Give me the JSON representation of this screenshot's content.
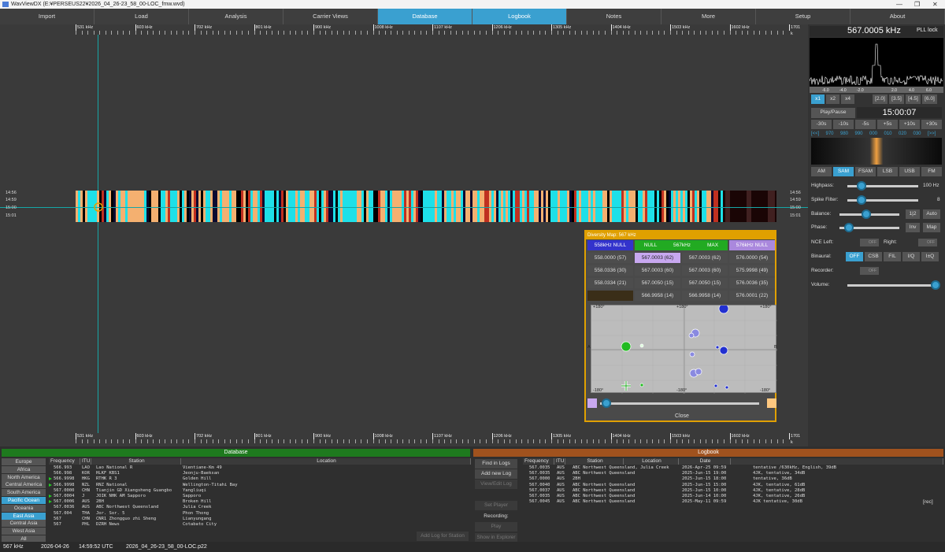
{
  "window": {
    "title": "WavViewDX (E:¥PERSEUS22¥2026_04_26-23_58_00-LOC_fmw.wvd)",
    "controls": [
      "—",
      "❐",
      "✕"
    ]
  },
  "menu": [
    "Import",
    "Load",
    "Analysis",
    "Carrier Views",
    "Database",
    "Logbook",
    "Notes",
    "More",
    "Setup",
    "About"
  ],
  "ruler": [
    "531 kHz",
    "603 kHz",
    "702 kHz",
    "801 kHz",
    "900 kHz",
    "1008 kHz",
    "1107 kHz",
    "1206 kHz",
    "1305 kHz",
    "1404 kHz",
    "1503 kHz",
    "1602 kHz",
    "1701 k"
  ],
  "times_left": [
    "14:56",
    "14:59",
    "15:00",
    "15:01"
  ],
  "times_right": [
    "14:56",
    "14:59",
    "15:00",
    "15:01"
  ],
  "diversity": {
    "title": "Diversity Map: 567 kHz",
    "headers": [
      "558kHz NULL",
      "NULL",
      "567kHz",
      "MAX",
      "576kHz NULL"
    ],
    "col1": [
      "558.0000 (57)",
      "558.0336 (30)",
      "558.0334 (21)",
      ""
    ],
    "col2": [
      "567.0003 (62)",
      "567.0003 (60)",
      "567.0050 (15)",
      "566.9958 (14)"
    ],
    "col3": [
      "567.0003 (62)",
      "567.0003 (60)",
      "567.0050 (15)",
      "566.9958 (14)"
    ],
    "col4": [
      "576.0000 (54)",
      "575.9998 (49)",
      "576.0036 (35)",
      "576.0001 (22)"
    ],
    "plot_labels": {
      "tl": "+180°",
      "tc": "+180°",
      "tr": "+180°",
      "bl": "-180°",
      "bc": "-180°",
      "br": "-180°",
      "left": "A",
      "right": "B"
    },
    "close": "Close",
    "colors": {
      "header": "#e0a000",
      "null558": "#3333cc",
      "null567": "#22aa22",
      "null576": "#aa88dd",
      "sel": "#c8a8f0"
    }
  },
  "receiver": {
    "frequency": "567.0005 kHz",
    "pll": "PLL lock",
    "spec_ticks": [
      "-6.0",
      "-4.0",
      "-2.0",
      "",
      "2.0",
      "4.0",
      "6.0"
    ],
    "zoom": [
      "x1",
      "x2",
      "x4"
    ],
    "bw": [
      "[2.0]",
      "[3.5]",
      "[4.5]",
      "[6.0]"
    ],
    "play": "Play/Pause",
    "time": "15:00:07",
    "seek": [
      "-30s",
      "-10s",
      "-5s",
      "+5s",
      "+10s",
      "+30s"
    ],
    "scale": [
      "[<<]",
      "970",
      "980",
      "990",
      "000",
      "010",
      "020",
      "030",
      "[>>]"
    ],
    "modes": [
      "AM",
      "SAM",
      "FSAM",
      "LSB",
      "USB",
      "FM"
    ],
    "highpass_label": "Highpass:",
    "highpass_value": "100 Hz",
    "spike_label": "Spike Filter:",
    "spike_value": "8",
    "balance_label": "Balance:",
    "balance_btns": [
      "1|2",
      "Auto"
    ],
    "phase_label": "Phase:",
    "phase_btns": [
      "Inv",
      "Map"
    ],
    "nce_left": "NCE Left:",
    "nce_right": "Right:",
    "off": "OFF",
    "binaural_label": "Binaural:",
    "binaural": [
      "OFF",
      "CSB",
      "FIL",
      "I/Q",
      "I±Q"
    ],
    "recorder_label": "Recorder:",
    "volume_label": "Volume:"
  },
  "database": {
    "title": "Database",
    "regions": [
      "Europe",
      "Africa",
      "North America",
      "Central America",
      "South America",
      "Pacific Ocean",
      "Oceania",
      "East Asia",
      "Central Asia",
      "West Asia",
      "All"
    ],
    "columns": [
      "Frequency",
      "ITU",
      "Station",
      "Location"
    ],
    "rows": [
      [
        "566.993",
        "LAO",
        "Lao National R",
        "Vientiane-Km 49",
        false
      ],
      [
        "566.998",
        "KOR",
        "HLKF KBS1",
        "Jeonju-Baeksan",
        false
      ],
      [
        "566.9998",
        "HKG",
        "RTHK R 3",
        "Golden Hill",
        true
      ],
      [
        "566.9998",
        "NZL",
        "RNZ National",
        "Wellington-Titahi Bay",
        true
      ],
      [
        "567.0000",
        "CHN",
        "Tianjin GD Xiangsheng Guangbo",
        "Yangliuqi",
        false
      ],
      [
        "567.0004",
        "J",
        "JOIK NHK AM Sapporo",
        "Sapporo",
        true
      ],
      [
        "567.0006",
        "AUS",
        "2BH",
        "Broken Hill",
        true
      ],
      [
        "567.0036",
        "AUS",
        "ABC Northwest Queensland",
        "Julia Creek",
        false
      ],
      [
        "567.004",
        "THA",
        "Jor. Sor. 5",
        "Phon Thong",
        false
      ],
      [
        "567",
        "CHN",
        "CNR1 Zhongguo zhi Sheng",
        "Lianyungang",
        false
      ],
      [
        "567",
        "PHL",
        "DZRH News",
        "Cotabato City",
        false
      ]
    ],
    "add_log": "Add Log for Station"
  },
  "logbook": {
    "title": "Logbook",
    "buttons": [
      "Find in Logs",
      "Add new Log",
      "View/Edit Log",
      "Set Player",
      "Recording:",
      "Play",
      "Show in Explorer"
    ],
    "columns": [
      "Frequency",
      "ITU",
      "Station",
      "Location",
      "Date",
      ""
    ],
    "rows": [
      [
        "567.0035",
        "AUS",
        "ABC Northwest Queensland, Julia Creek",
        "2026-Apr-25 09:59",
        "tentative /630kHz, English, 39dB"
      ],
      [
        "567.0035",
        "AUS",
        "ABC Northwest Queensland",
        "2025-Jun-15 19:00",
        "4JK, tentative, 34dB"
      ],
      [
        "567.0000",
        "AUS",
        "2BH",
        "2025-Jun-15 18:00",
        "tentative, 36dB"
      ],
      [
        "567.0040",
        "AUS",
        "ABC Northwest Queensland",
        "2025-Jun-15 15:00",
        "4JK, tentative, 61dB"
      ],
      [
        "567.0037",
        "AUS",
        "ABC Northwest Queensland",
        "2025-Jun-15 10:00",
        "4JK, tentative, 28dB"
      ],
      [
        "567.0035",
        "AUS",
        "ABC Northwest Queensland",
        "2025-Jun-14 10:00",
        "4JK, tentative, 26dB"
      ],
      [
        "567.0045",
        "AUS",
        "ABC Northwest Queensland",
        "2025-May-11 09:59",
        "4JK tentative, 30dB"
      ]
    ],
    "rec": "[rec]",
    "colors": {
      "header": "#a0521e"
    }
  },
  "status": [
    "567 kHz",
    "2026-04-26",
    "14:59:52 UTC",
    "2026_04_26-23_58_00-LOC.p22"
  ]
}
